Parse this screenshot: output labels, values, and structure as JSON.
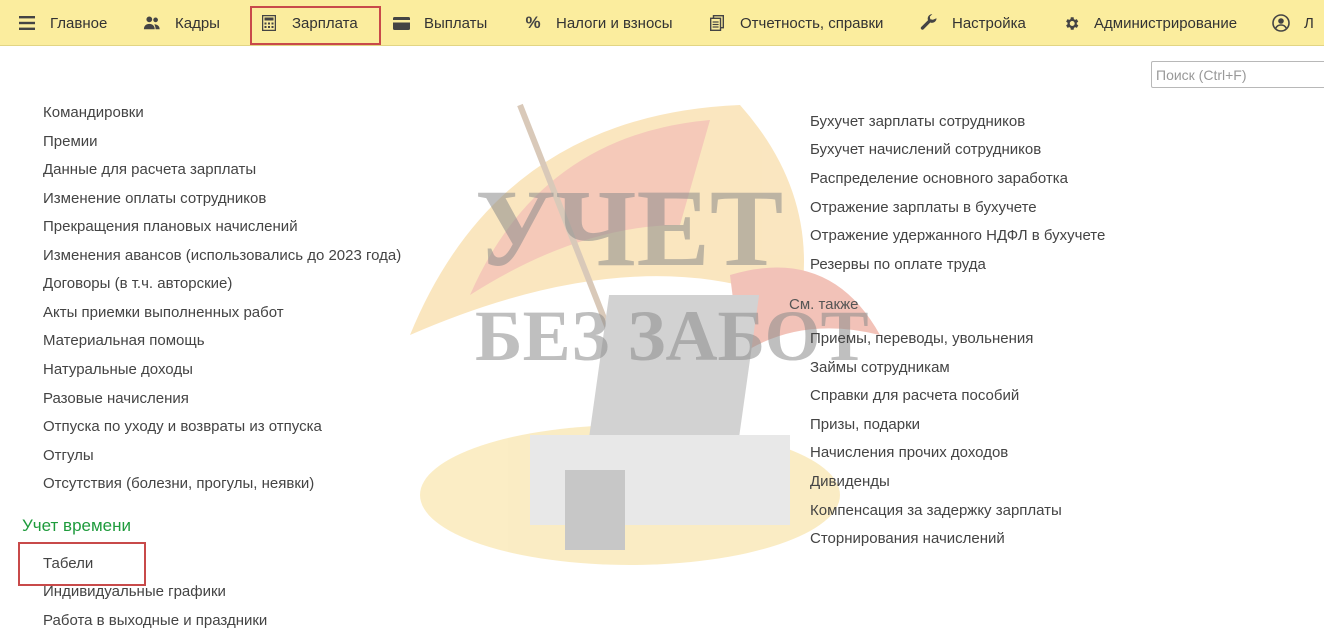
{
  "menu": {
    "items": [
      {
        "label": "Главное",
        "icon": "hamburger-icon"
      },
      {
        "label": "Кадры",
        "icon": "users-icon"
      },
      {
        "label": "Зарплата",
        "icon": "calculator-icon"
      },
      {
        "label": "Выплаты",
        "icon": "wallet-icon"
      },
      {
        "label": "Налоги и взносы",
        "icon": "percent-icon"
      },
      {
        "label": "Отчетность, справки",
        "icon": "documents-icon"
      },
      {
        "label": "Настройка",
        "icon": "wrench-icon"
      },
      {
        "label": "Администрирование",
        "icon": "gear-icon"
      },
      {
        "label": "Л",
        "icon": "user-circle-icon"
      }
    ]
  },
  "search": {
    "placeholder": "Поиск (Ctrl+F)"
  },
  "watermark": {
    "line1": "УЧЕТ",
    "line2": "БЕЗ ЗАБОТ"
  },
  "left_column": {
    "links": [
      "Командировки",
      "Премии",
      "Данные для расчета зарплаты",
      "Изменение оплаты сотрудников",
      "Прекращения плановых начислений",
      "Изменения авансов (использовались до 2023 года)",
      "Договоры (в т.ч. авторские)",
      "Акты приемки выполненных работ",
      "Материальная помощь",
      "Натуральные доходы",
      "Разовые начисления",
      "Отпуска по уходу и возвраты из отпуска",
      "Отгулы",
      "Отсутствия (болезни, прогулы, неявки)"
    ],
    "section_title": "Учет времени",
    "time_links": [
      "Табели",
      "Индивидуальные графики",
      "Работа в выходные и праздники"
    ]
  },
  "right_column": {
    "links": [
      "Бухучет зарплаты сотрудников",
      "Бухучет начислений сотрудников",
      "Распределение основного заработка",
      "Отражение зарплаты в бухучете",
      "Отражение удержанного НДФЛ в бухучете",
      "Резервы по оплате труда"
    ],
    "see_also_label": "См. также",
    "see_also_links": [
      "Приемы, переводы, увольнения",
      "Займы сотрудникам",
      "Справки для расчета пособий",
      "Призы, подарки",
      "Начисления прочих доходов",
      "Дивиденды",
      "Компенсация за задержку зарплаты",
      "Сторнирования начислений"
    ]
  },
  "colors": {
    "menubar": "#fbed9e",
    "section_title": "#1e9b3c",
    "highlight": "#c84a4a"
  }
}
